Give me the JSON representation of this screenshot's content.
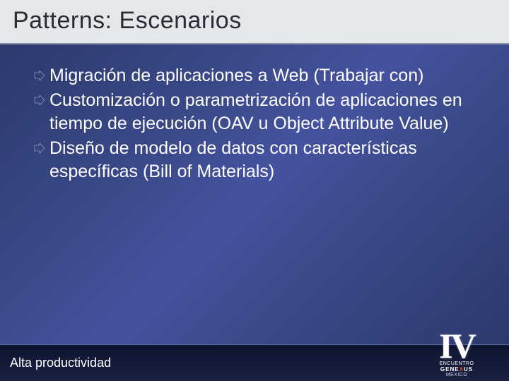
{
  "title": "Patterns: Escenarios",
  "bullets": [
    "Migración de aplicaciones a Web (Trabajar con)",
    "Customización o parametrización de aplicaciones en tiempo de ejecución (OAV u Object Attribute Value)",
    "Diseño de modelo de datos con características específicas (Bill of Materials)"
  ],
  "footer": "Alta productividad",
  "logo": {
    "roman": "IV",
    "line1": "ENCUENTRO",
    "brand_pre": "GENE",
    "brand_x": "X",
    "brand_post": "US",
    "line3": "MEXICO"
  }
}
